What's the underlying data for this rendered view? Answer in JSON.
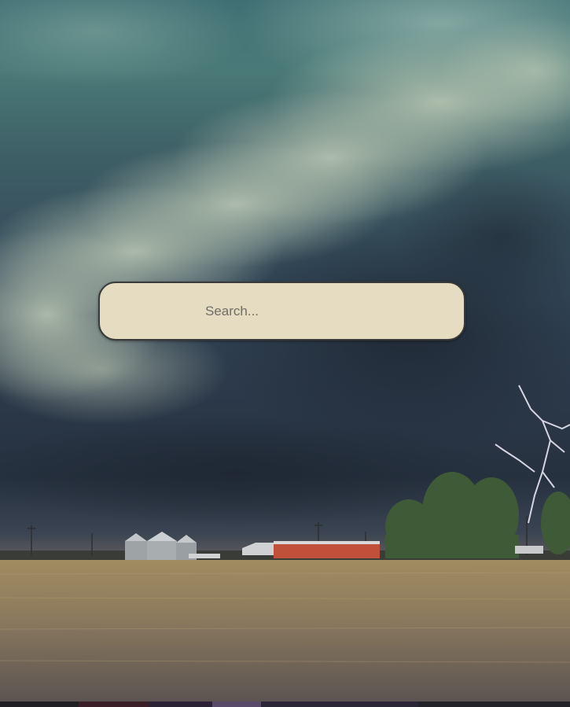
{
  "background": {
    "scene": "storm-landscape",
    "sky_color": "#34495a",
    "cloud_color": "#a9b8a6",
    "field_color": "#8a7a5c",
    "barn_color": "#c0503a",
    "tree_color": "#3f5a36"
  },
  "search": {
    "placeholder": "Search...",
    "value": "",
    "box_color": "#e6dcc2",
    "border_color": "#3a3a3a"
  },
  "taskbar": {
    "colors": [
      "#1f1f24",
      "#3a1e28",
      "#2b2236",
      "#5a4a6a",
      "#2a2638",
      "#222228"
    ]
  }
}
